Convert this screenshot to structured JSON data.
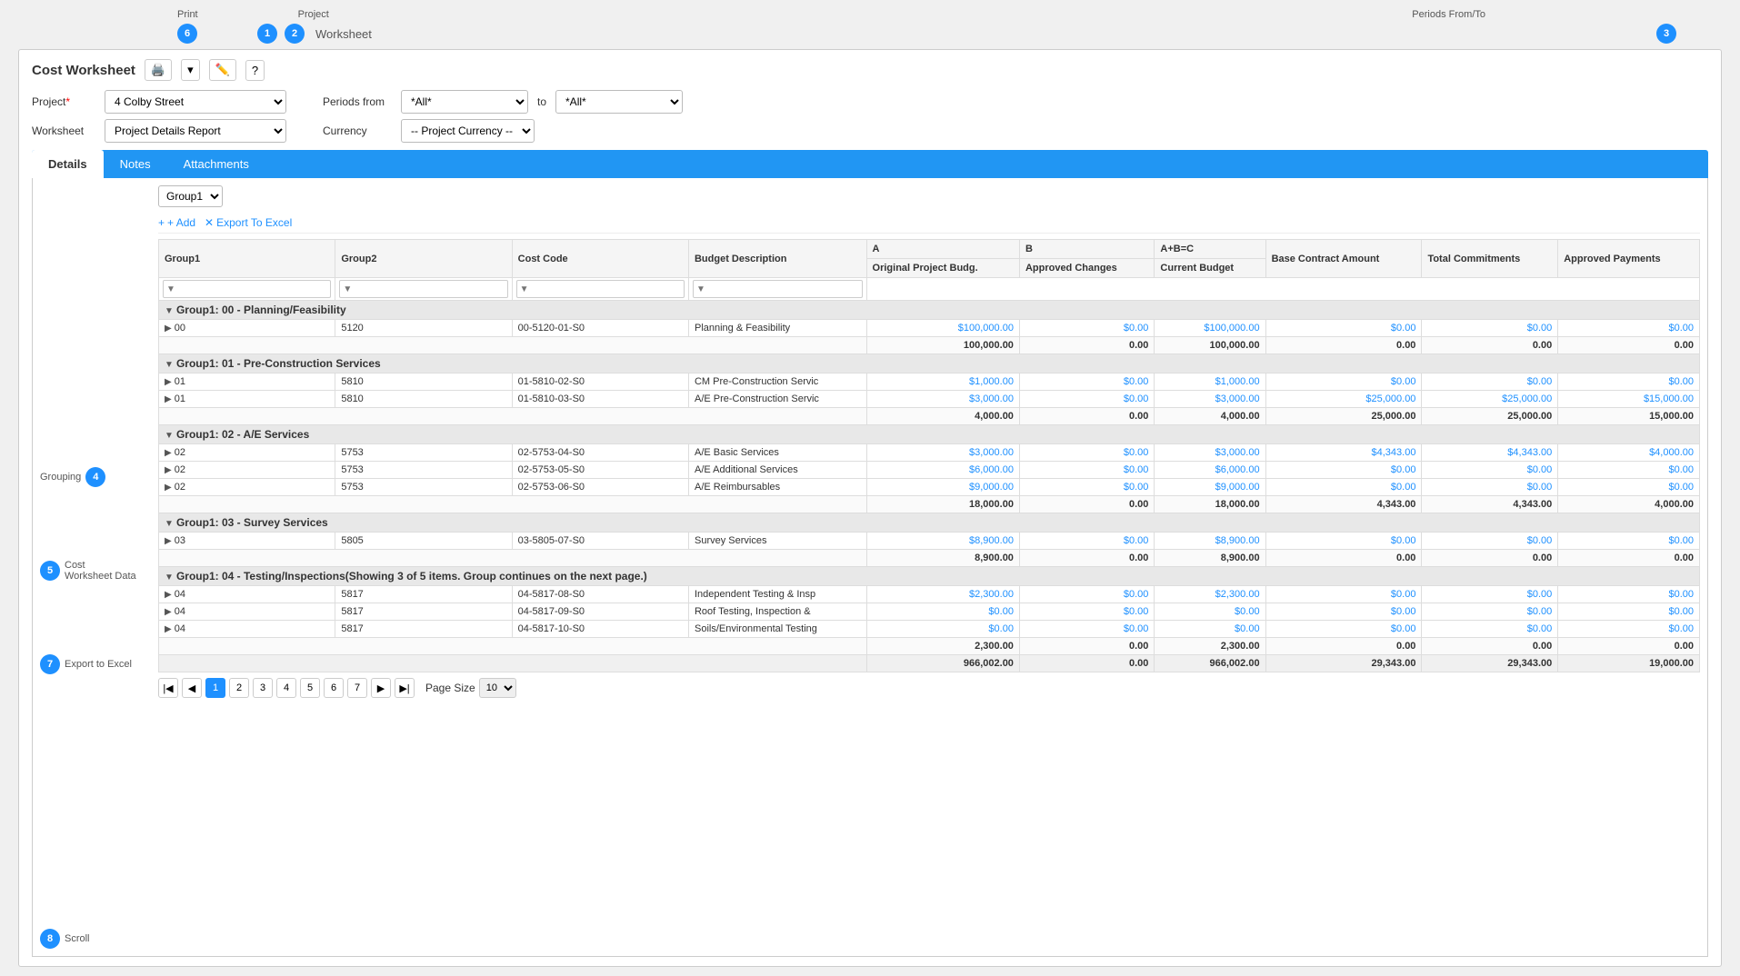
{
  "app": {
    "title": "Cost Worksheet"
  },
  "top_labels": {
    "print": "Print",
    "project": "Project",
    "worksheet_label": "Worksheet",
    "periods_from_to": "Periods From/To"
  },
  "badges": {
    "print_num": "6",
    "project_num": "1",
    "worksheet_num": "2",
    "periods_num": "3",
    "grouping_num": "4",
    "cost_data_num": "5",
    "export_num": "7",
    "scroll_num": "8"
  },
  "form": {
    "project_label": "Project",
    "worksheet_label": "Worksheet",
    "project_value": "4 Colby Street",
    "worksheet_value": "Project Details Report",
    "periods_from_label": "Periods from",
    "periods_from_value": "*All*",
    "periods_to_label": "to",
    "periods_to_value": "*All*",
    "currency_label": "Currency",
    "currency_value": "-- Project Currency --"
  },
  "tabs": [
    {
      "label": "Details",
      "active": true
    },
    {
      "label": "Notes",
      "active": false
    },
    {
      "label": "Attachments",
      "active": false
    }
  ],
  "grouping": {
    "label": "Grouping",
    "value": "Group1"
  },
  "toolbar": {
    "add_label": "+ Add",
    "export_label": "Export To Excel"
  },
  "table_headers": {
    "group1": "Group1",
    "group2": "Group2",
    "cost_code": "Cost Code",
    "budget_description": "Budget Description",
    "col_a": "A",
    "col_b": "B",
    "col_abc": "A+B=C",
    "original_budget": "Original Project Budg.",
    "approved_changes": "Approved Changes",
    "current_budget": "Current Budget",
    "base_contract": "Base Contract Amount",
    "total_commitments": "Total Commitments",
    "approved_payments": "Approved Payments"
  },
  "groups": [
    {
      "id": "group00",
      "title": "Group1: 00 - Planning/Feasibility",
      "rows": [
        {
          "expand": true,
          "group1": "00",
          "group2": "5120",
          "cost_code": "00-5120-01-S0",
          "description": "Planning & Feasibility",
          "orig_budget": "$100,000.00",
          "approved_changes": "$0.00",
          "current_budget": "$100,000.00",
          "base_contract": "$0.00",
          "total_commitments": "$0.00",
          "approved_payments": "$0.00"
        }
      ],
      "subtotal": {
        "orig_budget": "100,000.00",
        "approved_changes": "0.00",
        "current_budget": "100,000.00",
        "base_contract": "0.00",
        "total_commitments": "0.00",
        "approved_payments": "0.00"
      }
    },
    {
      "id": "group01",
      "title": "Group1: 01 - Pre-Construction Services",
      "rows": [
        {
          "expand": true,
          "group1": "01",
          "group2": "5810",
          "cost_code": "01-5810-02-S0",
          "description": "CM Pre-Construction Servic",
          "orig_budget": "$1,000.00",
          "approved_changes": "$0.00",
          "current_budget": "$1,000.00",
          "base_contract": "$0.00",
          "total_commitments": "$0.00",
          "approved_payments": "$0.00"
        },
        {
          "expand": true,
          "group1": "01",
          "group2": "5810",
          "cost_code": "01-5810-03-S0",
          "description": "A/E Pre-Construction Servic",
          "orig_budget": "$3,000.00",
          "approved_changes": "$0.00",
          "current_budget": "$3,000.00",
          "base_contract": "$25,000.00",
          "total_commitments": "$25,000.00",
          "approved_payments": "$15,000.00"
        }
      ],
      "subtotal": {
        "orig_budget": "4,000.00",
        "approved_changes": "0.00",
        "current_budget": "4,000.00",
        "base_contract": "25,000.00",
        "total_commitments": "25,000.00",
        "approved_payments": "15,000.00"
      }
    },
    {
      "id": "group02",
      "title": "Group1: 02 - A/E Services",
      "rows": [
        {
          "expand": true,
          "group1": "02",
          "group2": "5753",
          "cost_code": "02-5753-04-S0",
          "description": "A/E Basic Services",
          "orig_budget": "$3,000.00",
          "approved_changes": "$0.00",
          "current_budget": "$3,000.00",
          "base_contract": "$4,343.00",
          "total_commitments": "$4,343.00",
          "approved_payments": "$4,000.00"
        },
        {
          "expand": true,
          "group1": "02",
          "group2": "5753",
          "cost_code": "02-5753-05-S0",
          "description": "A/E Additional Services",
          "orig_budget": "$6,000.00",
          "approved_changes": "$0.00",
          "current_budget": "$6,000.00",
          "base_contract": "$0.00",
          "total_commitments": "$0.00",
          "approved_payments": "$0.00"
        },
        {
          "expand": true,
          "group1": "02",
          "group2": "5753",
          "cost_code": "02-5753-06-S0",
          "description": "A/E Reimbursables",
          "orig_budget": "$9,000.00",
          "approved_changes": "$0.00",
          "current_budget": "$9,000.00",
          "base_contract": "$0.00",
          "total_commitments": "$0.00",
          "approved_payments": "$0.00"
        }
      ],
      "subtotal": {
        "orig_budget": "18,000.00",
        "approved_changes": "0.00",
        "current_budget": "18,000.00",
        "base_contract": "4,343.00",
        "total_commitments": "4,343.00",
        "approved_payments": "4,000.00"
      }
    },
    {
      "id": "group03",
      "title": "Group1: 03 - Survey Services",
      "rows": [
        {
          "expand": true,
          "group1": "03",
          "group2": "5805",
          "cost_code": "03-5805-07-S0",
          "description": "Survey Services",
          "orig_budget": "$8,900.00",
          "approved_changes": "$0.00",
          "current_budget": "$8,900.00",
          "base_contract": "$0.00",
          "total_commitments": "$0.00",
          "approved_payments": "$0.00"
        }
      ],
      "subtotal": {
        "orig_budget": "8,900.00",
        "approved_changes": "0.00",
        "current_budget": "8,900.00",
        "base_contract": "0.00",
        "total_commitments": "0.00",
        "approved_payments": "0.00"
      }
    },
    {
      "id": "group04",
      "title": "Group1: 04 - Testing/Inspections(Showing 3 of 5 items. Group continues on the next page.)",
      "rows": [
        {
          "expand": true,
          "group1": "04",
          "group2": "5817",
          "cost_code": "04-5817-08-S0",
          "description": "Independent Testing & Insp",
          "orig_budget": "$2,300.00",
          "approved_changes": "$0.00",
          "current_budget": "$2,300.00",
          "base_contract": "$0.00",
          "total_commitments": "$0.00",
          "approved_payments": "$0.00"
        },
        {
          "expand": true,
          "group1": "04",
          "group2": "5817",
          "cost_code": "04-5817-09-S0",
          "description": "Roof Testing, Inspection &",
          "orig_budget": "$0.00",
          "approved_changes": "$0.00",
          "current_budget": "$0.00",
          "base_contract": "$0.00",
          "total_commitments": "$0.00",
          "approved_payments": "$0.00"
        },
        {
          "expand": true,
          "group1": "04",
          "group2": "5817",
          "cost_code": "04-5817-10-S0",
          "description": "Soils/Environmental Testing",
          "orig_budget": "$0.00",
          "approved_changes": "$0.00",
          "current_budget": "$0.00",
          "base_contract": "$0.00",
          "total_commitments": "$0.00",
          "approved_payments": "$0.00"
        }
      ],
      "subtotal": {
        "orig_budget": "2,300.00",
        "approved_changes": "0.00",
        "current_budget": "2,300.00",
        "base_contract": "0.00",
        "total_commitments": "0.00",
        "approved_payments": "0.00"
      }
    }
  ],
  "grand_total": {
    "orig_budget": "966,002.00",
    "approved_changes": "0.00",
    "current_budget": "966,002.00",
    "base_contract": "29,343.00",
    "total_commitments": "29,343.00",
    "approved_payments": "19,000.00"
  },
  "pagination": {
    "pages": [
      "1",
      "2",
      "3",
      "4",
      "5",
      "6",
      "7"
    ],
    "current_page": "1",
    "page_size_label": "Page Size",
    "page_size_value": "10"
  },
  "side_labels": {
    "grouping": "Grouping",
    "cost_worksheet_data": "Cost\nWorksheet Data",
    "export_to_excel": "Export to Excel",
    "scroll": "Scroll"
  }
}
